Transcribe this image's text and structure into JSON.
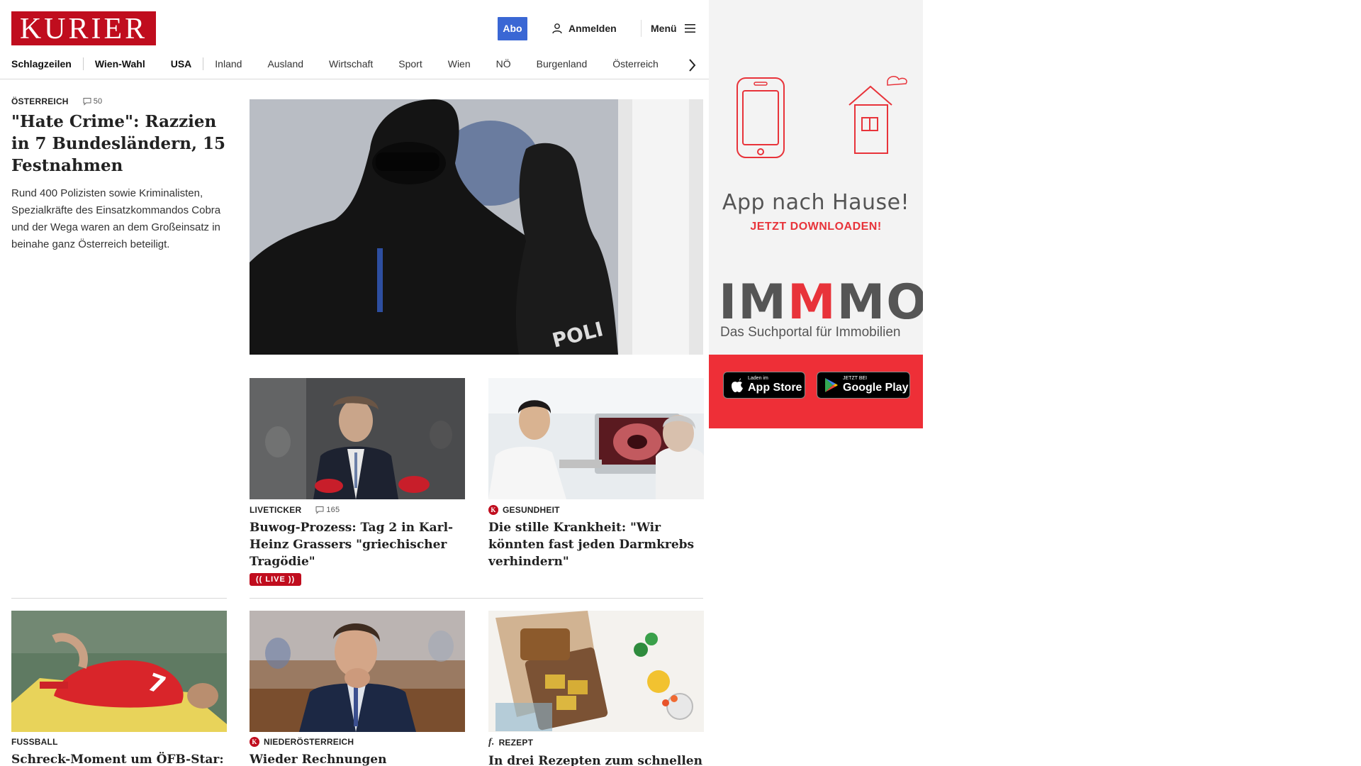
{
  "header": {
    "logo_text": "KURIER",
    "abo_label": "Abo",
    "login_label": "Anmelden",
    "menu_label": "Menü"
  },
  "nav": {
    "items": [
      "Schlagzeilen",
      "Wien-Wahl",
      "USA",
      "Inland",
      "Ausland",
      "Wirtschaft",
      "Sport",
      "Wien",
      "NÖ",
      "Burgenland",
      "Österreich"
    ]
  },
  "lead": {
    "kicker": "ÖSTERREICH",
    "comments": "50",
    "headline": "\"Hate Crime\": Razzien in 7 Bundesländern, 15 Festnahmen",
    "description": "Rund 400 Polizisten sowie Kriminalisten, Spezialkräfte des Einsatzkommandos Cobra und der Wega waren an dem Großeinsatz in beinahe ganz Österreich beteiligt.",
    "image_text": "POLI"
  },
  "cards": [
    {
      "kicker": "LIVETICKER",
      "comments": "165",
      "headline": "Buwog-Prozess: Tag 2 in Karl-Heinz Grassers \"griechischer Tragödie\"",
      "badge": "(( LIVE ))"
    },
    {
      "kicker": "GESUNDHEIT",
      "badge_icon": "K",
      "headline": "Die stille Krankheit: \"Wir könnten fast jeden Darmkrebs verhindern\""
    },
    {
      "kicker": "FUSSBALL",
      "headline": "Schreck-Moment um ÖFB-Star: Arnautovic erlitt im Serbien-Spiel"
    },
    {
      "kicker": "NIEDERÖSTERREICH",
      "badge_icon": "K",
      "headline": "Wieder Rechnungen manipuliert? Neue Ermittlungen gegen Hannes"
    },
    {
      "kicker": "REZEPT",
      "badge_icon": "f.",
      "headline": "In drei Rezepten zum schnellen Picknick-Menü"
    }
  ],
  "ad": {
    "title": "App nach Hause!",
    "subtitle": "JETZT DOWNLOADEN!",
    "brand_a": "IM",
    "brand_b": "M",
    "brand_c": "MO",
    "brand_sub": "Das Suchportal für Immobilien",
    "appstore_small": "Laden im",
    "appstore_big": "App Store",
    "googleplay_small": "JETZT BEI",
    "googleplay_big": "Google Play"
  },
  "colors": {
    "brand_red": "#c00d1e",
    "abo_blue": "#3a67d4",
    "ad_red": "#ee2f37"
  }
}
